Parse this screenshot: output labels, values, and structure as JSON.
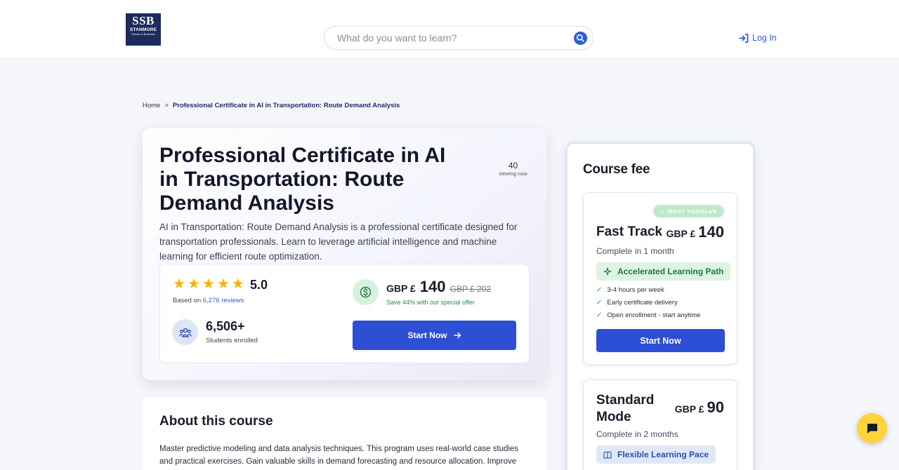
{
  "header": {
    "logo": {
      "line1": "SSB",
      "line2": "STANMORE",
      "line3": "School of Business"
    },
    "search_placeholder": "What do you want to learn?",
    "login_label": "Log In"
  },
  "breadcrumb": {
    "home": "Home",
    "separator": ">",
    "current": "Professional Certificate in AI in Transportation: Route Demand Analysis"
  },
  "course": {
    "title": "Professional Certificate in AI in Transportation: Route Demand Analysis",
    "viewing_count": "40",
    "viewing_label": "viewing now",
    "description": "AI in Transportation: Route Demand Analysis is a professional certificate designed for transportation professionals. Learn to leverage artificial intelligence and machine learning for efficient route optimization.",
    "rating": "5.0",
    "stars": 5,
    "based_on_prefix": "Based on",
    "reviews_link": "6,276 reviews",
    "students_count": "6,506+",
    "students_label": "Students enrolled",
    "price_currency": "GBP £",
    "price_amount": "140",
    "price_old": "GBP £ 202",
    "save_text": "Save 44% with our special offer",
    "start_label": "Start Now"
  },
  "about": {
    "title": "About this course",
    "text": "Master predictive modeling and data analysis techniques. This program uses real-world case studies and practical exercises. Gain valuable skills in demand forecasting and resource allocation. Improve"
  },
  "fee": {
    "title": "Course fee",
    "plans": [
      {
        "badge": "MOST POPULAR",
        "name": "Fast Track",
        "currency": "GBP £",
        "amount": "140",
        "duration": "Complete in 1 month",
        "tag": "Accelerated Learning Path",
        "features": [
          "3-4 hours per week",
          "Early certificate delivery",
          "Open enrollment - start anytime"
        ],
        "button": "Start Now"
      },
      {
        "name": "Standard Mode",
        "currency": "GBP £",
        "amount": "90",
        "duration": "Complete in 2 months",
        "tag": "Flexible Learning Pace"
      }
    ]
  },
  "colors": {
    "brand_blue": "#2d4fd4",
    "link_blue": "#2c5ed8",
    "star": "#f5b400",
    "chat": "#ffd43b",
    "logo_bg": "#1c2a5e"
  },
  "icons": {
    "search": "search-icon",
    "login": "login-arrow-icon",
    "students": "students-icon",
    "price": "dollar-icon",
    "chat": "chat-icon"
  }
}
